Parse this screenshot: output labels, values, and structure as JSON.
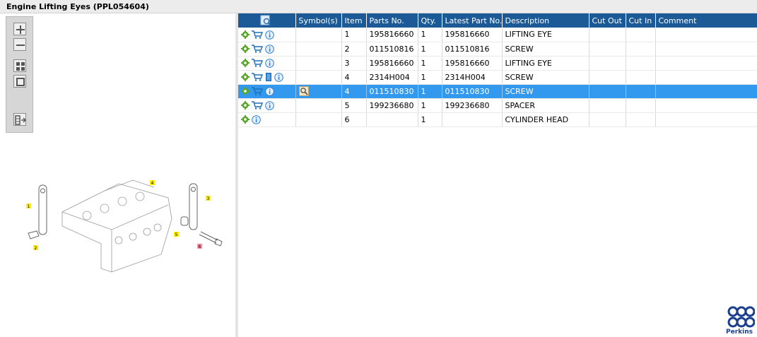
{
  "window": {
    "title": "Engine Lifting Eyes (PPL054604)"
  },
  "toolbox": {
    "buttons": [
      {
        "name": "zoom-in-icon"
      },
      {
        "name": "zoom-out-icon"
      },
      {
        "name": "fit-all-icon"
      },
      {
        "name": "fit-window-icon"
      },
      {
        "name": "toggle-layout-icon"
      }
    ]
  },
  "drawing": {
    "callouts": [
      "1",
      "2",
      "3",
      "4",
      "5",
      "6"
    ]
  },
  "table": {
    "columns": [
      "",
      "Symbol(s)",
      "Item",
      "Parts No.",
      "Qty.",
      "Latest Part No.",
      "Description",
      "Cut Out",
      "Cut In",
      "Comment"
    ],
    "rows": [
      {
        "icons": [
          "gear",
          "cart",
          "info"
        ],
        "symbol": "",
        "item": "1",
        "part_no": "195816660",
        "qty": "1",
        "latest": "195816660",
        "desc": "LIFTING EYE",
        "cut_out": "",
        "cut_in": "",
        "comment": ""
      },
      {
        "icons": [
          "gear",
          "cart",
          "info"
        ],
        "symbol": "",
        "item": "2",
        "part_no": "011510816",
        "qty": "1",
        "latest": "011510816",
        "desc": "SCREW",
        "cut_out": "",
        "cut_in": "",
        "comment": ""
      },
      {
        "icons": [
          "gear",
          "cart",
          "info"
        ],
        "symbol": "",
        "item": "3",
        "part_no": "195816660",
        "qty": "1",
        "latest": "195816660",
        "desc": "LIFTING EYE",
        "cut_out": "",
        "cut_in": "",
        "comment": ""
      },
      {
        "icons": [
          "gear",
          "cart",
          "book",
          "info"
        ],
        "symbol": "",
        "item": "4",
        "part_no": "2314H004",
        "qty": "1",
        "latest": "2314H004",
        "desc": "SCREW",
        "cut_out": "",
        "cut_in": "",
        "comment": ""
      },
      {
        "icons": [
          "gear",
          "cart",
          "info"
        ],
        "symbol": "magnifier",
        "item": "4",
        "part_no": "011510830",
        "qty": "1",
        "latest": "011510830",
        "desc": "SCREW",
        "cut_out": "",
        "cut_in": "",
        "comment": "",
        "selected": true
      },
      {
        "icons": [
          "gear",
          "cart",
          "info"
        ],
        "symbol": "",
        "item": "5",
        "part_no": "199236680",
        "qty": "1",
        "latest": "199236680",
        "desc": "SPACER",
        "cut_out": "",
        "cut_in": "",
        "comment": ""
      },
      {
        "icons": [
          "gear",
          "info"
        ],
        "symbol": "",
        "item": "6",
        "part_no": "",
        "qty": "1",
        "latest": "",
        "desc": "CYLINDER HEAD",
        "cut_out": "",
        "cut_in": "",
        "comment": ""
      }
    ]
  },
  "brand": {
    "name": "Perkins",
    "color": "#1b3f8f"
  },
  "colors": {
    "header": "#1b5a96",
    "selected": "#3399ee",
    "gear": "#5aa62a",
    "cart": "#1d6fb5",
    "info": "#2f7fd0"
  }
}
